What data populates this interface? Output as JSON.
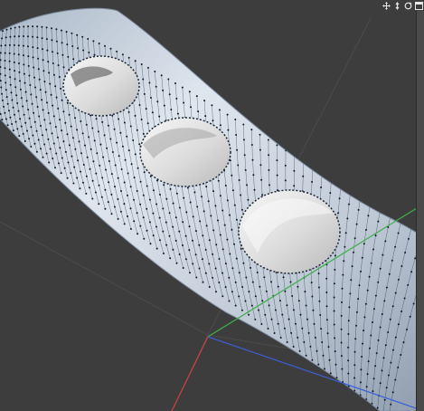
{
  "viewport": {
    "background": "#3d3d3d",
    "grid_color": "#4a4a4a",
    "axis_colors": {
      "x": "#d04040",
      "y": "#3fb04a",
      "z": "#3a5fd8"
    },
    "object": {
      "surface_color": "#c7d1dd",
      "wire_color": "#1c2c40",
      "point_color": "#0e1726",
      "holes": 3
    }
  },
  "nav_controls": [
    {
      "name": "move-view",
      "icon": "move-arrows-icon"
    },
    {
      "name": "zoom-view",
      "icon": "zoom-arrow-icon"
    },
    {
      "name": "rotate-view",
      "icon": "rotate-icon"
    },
    {
      "name": "toggle-view-layout",
      "icon": "window-toggle-icon"
    }
  ]
}
